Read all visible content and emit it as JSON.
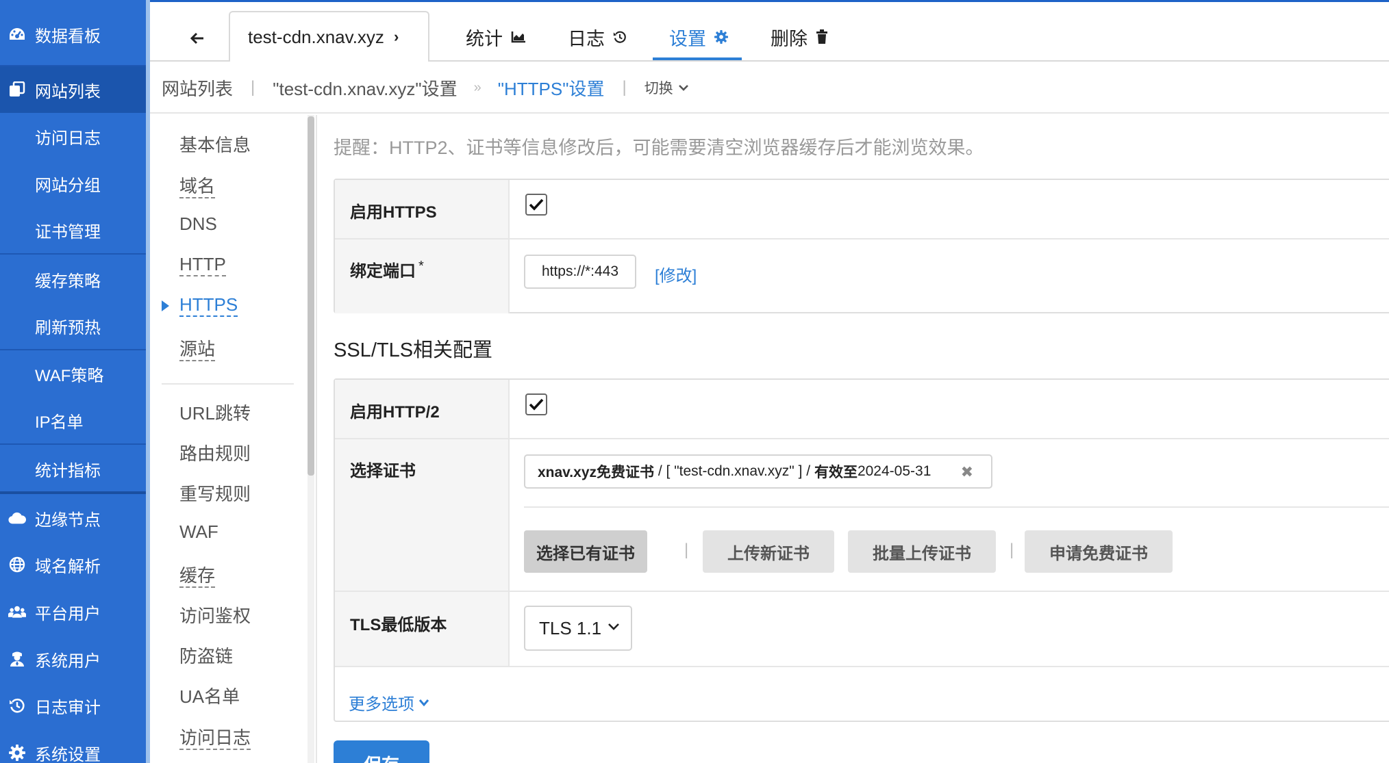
{
  "sidebar": {
    "items": [
      {
        "label": "数据看板",
        "icon": "dashboard-icon"
      },
      {
        "label": "网站列表",
        "icon": "copy-icon",
        "active": true
      },
      {
        "label": "访问日志"
      },
      {
        "label": "网站分组"
      },
      {
        "label": "证书管理"
      },
      {
        "label": "缓存策略"
      },
      {
        "label": "刷新预热"
      },
      {
        "label": "WAF策略"
      },
      {
        "label": "IP名单"
      },
      {
        "label": "统计指标"
      },
      {
        "label": "边缘节点",
        "icon": "cloud-icon"
      },
      {
        "label": "域名解析",
        "icon": "globe-icon"
      },
      {
        "label": "平台用户",
        "icon": "users-icon"
      },
      {
        "label": "系统用户",
        "icon": "user-shield-icon"
      },
      {
        "label": "日志审计",
        "icon": "history-icon"
      },
      {
        "label": "系统设置",
        "icon": "gear-icon"
      }
    ]
  },
  "topbar": {
    "site_tab": "test-cdn.xnav.xyz",
    "tabs": [
      {
        "label": "统计",
        "icon": "chart-icon"
      },
      {
        "label": "日志",
        "icon": "history-icon"
      },
      {
        "label": "设置",
        "icon": "gear-icon",
        "active": true
      },
      {
        "label": "删除",
        "icon": "trash-icon"
      }
    ]
  },
  "breadcrumb": {
    "root": "网站列表",
    "site": "\"test-cdn.xnav.xyz\"设置",
    "current": "\"HTTPS\"设置",
    "switch_label": "切换"
  },
  "settings_menu": {
    "items": [
      {
        "label": "基本信息"
      },
      {
        "label": "域名"
      },
      {
        "label": "DNS"
      },
      {
        "label": "HTTP"
      },
      {
        "label": "HTTPS",
        "active": true
      },
      {
        "label": "源站"
      },
      {
        "label": "URL跳转"
      },
      {
        "label": "路由规则"
      },
      {
        "label": "重写规则"
      },
      {
        "label": "WAF"
      },
      {
        "label": "缓存"
      },
      {
        "label": "访问鉴权"
      },
      {
        "label": "防盗链"
      },
      {
        "label": "UA名单"
      },
      {
        "label": "访问日志"
      }
    ]
  },
  "content": {
    "tip": "提醒：HTTP2、证书等信息修改后，可能需要清空浏览器缓存后才能浏览效果。",
    "enable_https_label": "启用HTTPS",
    "enable_https_checked": true,
    "bind_port_label": "绑定端口",
    "bind_port_required": "*",
    "bind_port_value": "https://*:443",
    "modify_link": "[修改]",
    "ssl_section_title": "SSL/TLS相关配置",
    "enable_http2_label": "启用HTTP/2",
    "enable_http2_checked": true,
    "select_cert_label": "选择证书",
    "cert": {
      "name": "xnav.xyz免费证书",
      "sep1": " / [ ",
      "domains": "\"test-cdn.xnav.xyz\"",
      "sep2": " ] / ",
      "valid_label": "有效至",
      "valid_date": "2024-05-31"
    },
    "cert_buttons": [
      "选择已有证书",
      "上传新证书",
      "批量上传证书",
      "申请免费证书"
    ],
    "tls_min_label": "TLS最低版本",
    "tls_min_value": "TLS 1.1",
    "more_options": "更多选项",
    "save_button": "保存"
  }
}
